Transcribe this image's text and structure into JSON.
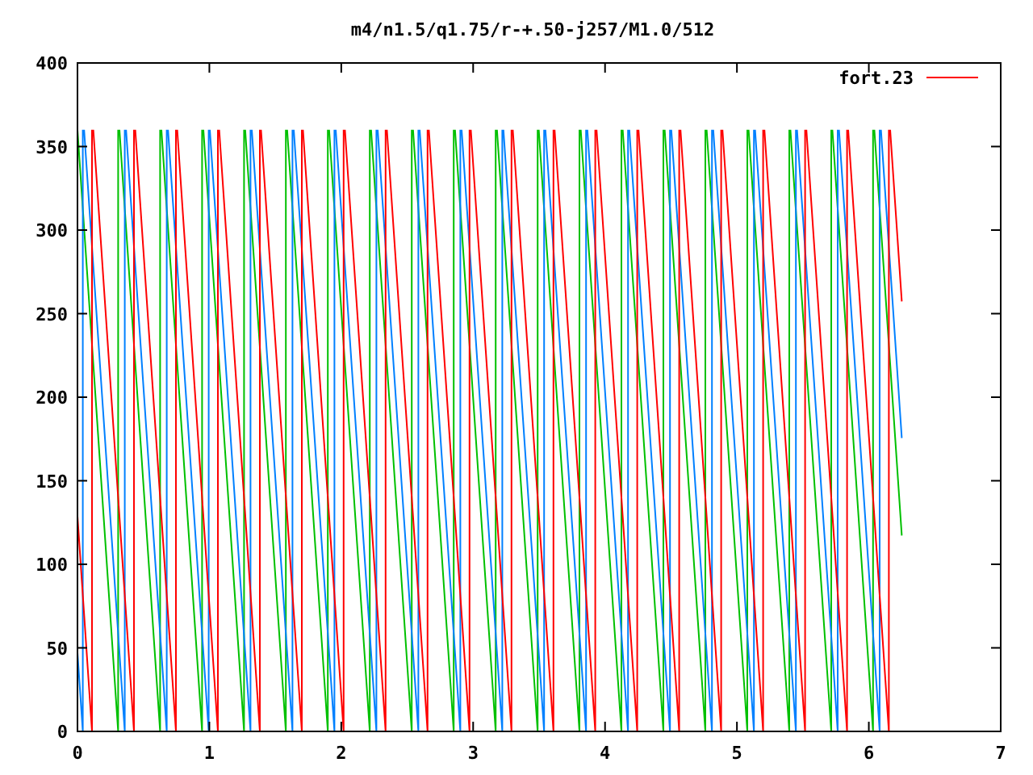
{
  "title": "m4/n1.5/q1.75/r-+.50-j257/M1.0/512",
  "y_ticks": [
    "400",
    "350",
    "300",
    "250",
    "200",
    "150",
    "100",
    "50",
    "0"
  ],
  "x_ticks": [
    "0",
    "1",
    "2",
    "3",
    "4",
    "5",
    "6",
    "7"
  ],
  "legend": {
    "label": "fort.23"
  }
}
